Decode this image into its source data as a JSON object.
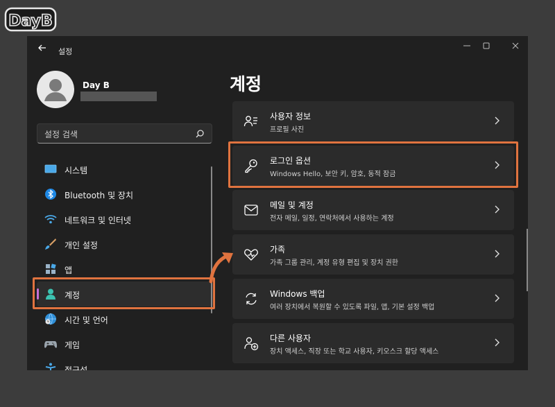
{
  "watermark": "DayB",
  "window": {
    "title": "설정"
  },
  "user": {
    "name": "Day B"
  },
  "search": {
    "placeholder": "설정 검색"
  },
  "sidebar": {
    "items": [
      {
        "label": "시스템",
        "icon": "display-icon"
      },
      {
        "label": "Bluetooth 및 장치",
        "icon": "bluetooth-icon"
      },
      {
        "label": "네트워크 및 인터넷",
        "icon": "wifi-icon"
      },
      {
        "label": "개인 설정",
        "icon": "brush-icon"
      },
      {
        "label": "앱",
        "icon": "apps-icon"
      },
      {
        "label": "계정",
        "icon": "account-icon",
        "active": true
      },
      {
        "label": "시간 및 언어",
        "icon": "globe-clock-icon"
      },
      {
        "label": "게임",
        "icon": "gamepad-icon"
      },
      {
        "label": "접근성",
        "icon": "accessibility-icon"
      }
    ]
  },
  "main": {
    "title": "계정",
    "cards": [
      {
        "title": "사용자 정보",
        "subtitle": "프로필 사진",
        "icon": "user-info-icon"
      },
      {
        "title": "로그인 옵션",
        "subtitle": "Windows Hello, 보안 키, 암호, 동적 잠금",
        "icon": "key-icon"
      },
      {
        "title": "메일 및 계정",
        "subtitle": "전자 메일, 일정, 연락처에서 사용하는 계정",
        "icon": "mail-icon"
      },
      {
        "title": "가족",
        "subtitle": "가족 그룹 관리, 계정 유형 편집 및 장치 권한",
        "icon": "family-heart-icon"
      },
      {
        "title": "Windows 백업",
        "subtitle": "여러 장치에서 복원할 수 있도록 파일, 앱, 기본 설정 백업",
        "icon": "backup-icon"
      },
      {
        "title": "다른 사용자",
        "subtitle": "장치 액세스, 직장 또는 학교 사용자, 키오스크 할당 액세스",
        "icon": "add-user-icon"
      }
    ]
  },
  "colors": {
    "highlight": "#e0733f",
    "accent": "#c76fd6",
    "background": "#202020",
    "card": "#2b2b2b"
  }
}
